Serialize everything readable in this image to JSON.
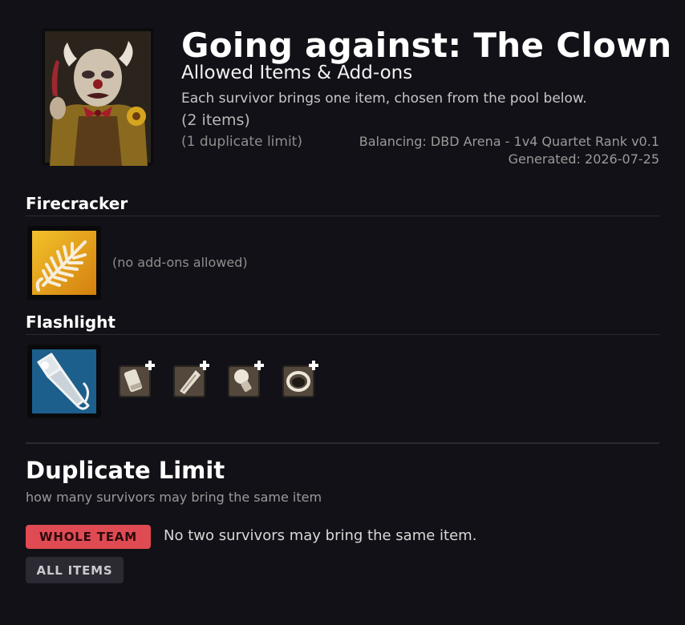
{
  "header": {
    "title": "Going against: The Clown",
    "subtitle": "Allowed Items & Add-ons",
    "description": "Each survivor brings one item, chosen from the pool below.",
    "item_count": "(2 items)",
    "duplicate_limit": "(1 duplicate limit)",
    "balancing": "Balancing: DBD Arena - 1v4 Quartet Rank v0.1",
    "generated": "Generated: 2026-07-25",
    "portrait_icon": "clown-portrait"
  },
  "items": [
    {
      "name": "Firecracker",
      "icon": "firecracker-icon",
      "icon_color": "#e9a21a",
      "addons_note": "(no add-ons allowed)",
      "addons": []
    },
    {
      "name": "Flashlight",
      "icon": "flashlight-icon",
      "icon_color": "#1c5f8c",
      "addons_note": "",
      "addons": [
        {
          "icon": "battery-addon-icon"
        },
        {
          "icon": "lens-tube-addon-icon"
        },
        {
          "icon": "bulb-addon-icon"
        },
        {
          "icon": "ring-lens-addon-icon"
        }
      ]
    }
  ],
  "duplicate_section": {
    "title": "Duplicate Limit",
    "subtitle": "how many survivors may bring the same item",
    "options": [
      {
        "label": "Whole Team",
        "selected": true,
        "color": "#e04a52"
      },
      {
        "label": "All Items",
        "selected": false,
        "color": "#2b2a33"
      }
    ],
    "selected_description": "No two survivors may bring the same item."
  }
}
